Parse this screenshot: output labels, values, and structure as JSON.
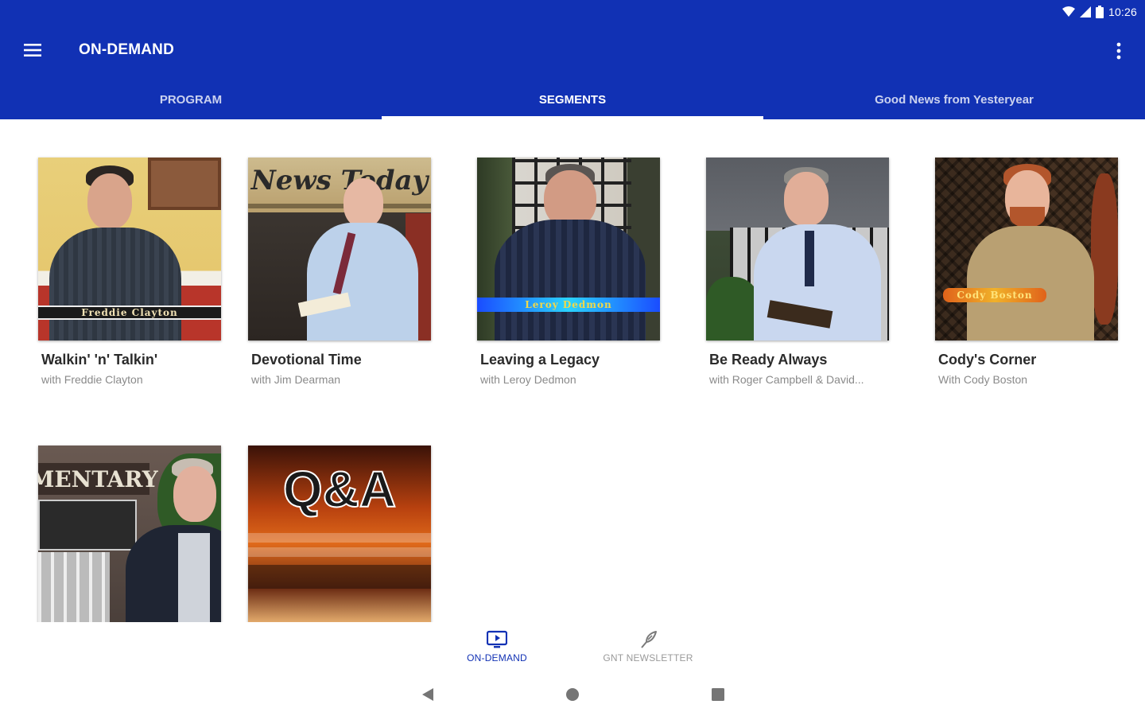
{
  "status_bar": {
    "time": "10:26",
    "icons": [
      "wifi-icon",
      "cell-signal-icon",
      "battery-icon"
    ]
  },
  "app_bar": {
    "title": "ON-DEMAND",
    "menu_icon": "menu-icon",
    "overflow_icon": "more-vert-icon",
    "color": "#1131b4"
  },
  "tabs": [
    {
      "label": "PROGRAM",
      "active": false
    },
    {
      "label": "SEGMENTS",
      "active": true
    },
    {
      "label": "Good News from Yesteryear",
      "active": false
    }
  ],
  "segments": [
    {
      "title": "Walkin' 'n' Talkin'",
      "subtitle": "with Freddie Clayton",
      "caption": "Freddie Clayton"
    },
    {
      "title": "Devotional Time",
      "subtitle": "with Jim Dearman",
      "caption": "News Today"
    },
    {
      "title": "Leaving a Legacy",
      "subtitle": "with Leroy Dedmon",
      "caption": "Leroy Dedmon"
    },
    {
      "title": "Be Ready Always",
      "subtitle": "with Roger Campbell & David...",
      "caption": ""
    },
    {
      "title": "Cody's Corner",
      "subtitle": "With Cody Boston",
      "caption": "Cody Boston"
    },
    {
      "title": "",
      "subtitle": "",
      "caption": "MENTARY"
    },
    {
      "title": "",
      "subtitle": "",
      "caption": "Q&A"
    }
  ],
  "bottom_nav": [
    {
      "label": "ON-DEMAND",
      "icon": "tv-icon",
      "active": true
    },
    {
      "label": "GNT NEWSLETTER",
      "icon": "quill-pen-icon",
      "active": false
    }
  ],
  "system_nav": [
    "back-icon",
    "home-icon",
    "recents-icon"
  ],
  "colors": {
    "primary": "#1131b4",
    "active_tab_indicator": "#ffffff",
    "inactive_nav_label": "#9a9a9a"
  }
}
